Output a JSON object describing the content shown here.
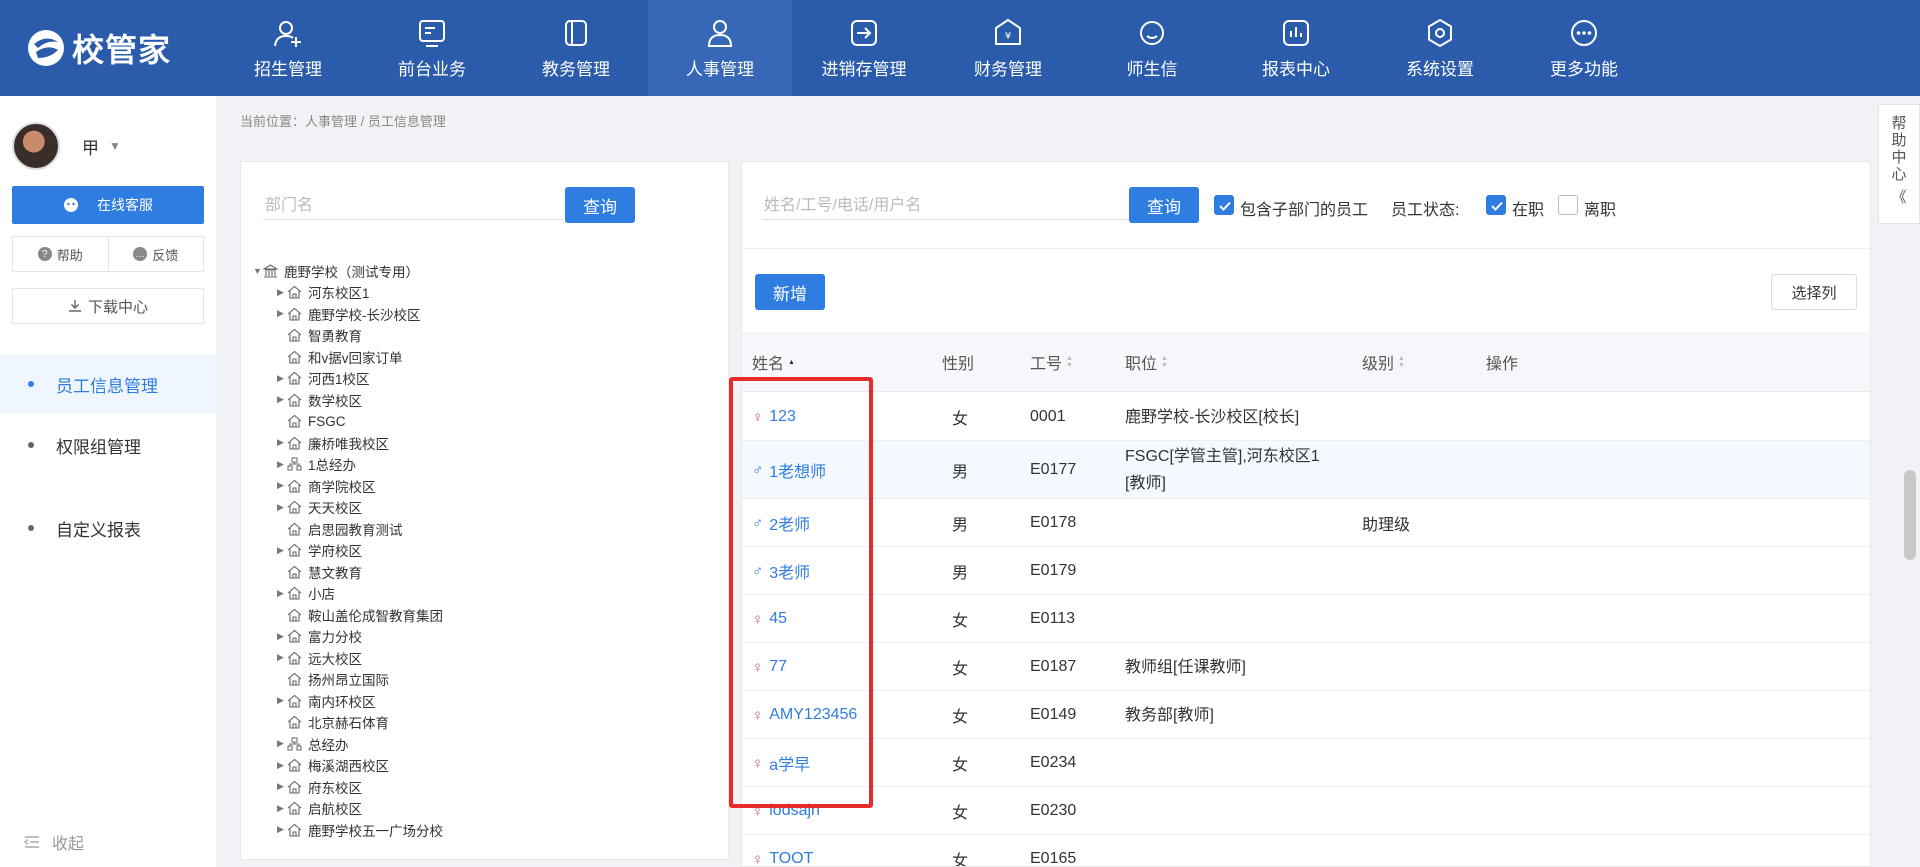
{
  "app": {
    "logo_text": "校管家",
    "brand_color": "#2b5cab",
    "accent": "#2f7de1"
  },
  "nav": [
    {
      "label": "招生管理",
      "icon": "user-plus-icon"
    },
    {
      "label": "前台业务",
      "icon": "monitor-icon"
    },
    {
      "label": "教务管理",
      "icon": "book-icon"
    },
    {
      "label": "人事管理",
      "icon": "person-icon",
      "active": true
    },
    {
      "label": "进销存管理",
      "icon": "exchange-icon"
    },
    {
      "label": "财务管理",
      "icon": "money-icon"
    },
    {
      "label": "师生信",
      "icon": "chat-icon"
    },
    {
      "label": "报表中心",
      "icon": "report-icon"
    },
    {
      "label": "系统设置",
      "icon": "settings-icon"
    },
    {
      "label": "更多功能",
      "icon": "more-icon"
    }
  ],
  "sidebar": {
    "user_name": "甲",
    "service_label": "在线客服",
    "help_label": "帮助",
    "feedback_label": "反馈",
    "download_label": "下载中心",
    "menu": [
      {
        "label": "员工信息管理",
        "active": true
      },
      {
        "label": "权限组管理"
      },
      {
        "label": "自定义报表"
      }
    ],
    "collapse_label": "收起"
  },
  "breadcrumb": "当前位置：人事管理 / 员工信息管理",
  "dept": {
    "search_placeholder": "部门名",
    "query_label": "查询",
    "tree": [
      {
        "label": "鹿野学校（测试专用）",
        "level": 0,
        "arrow": "▼",
        "icon": "bank-icon"
      },
      {
        "label": "河东校区1",
        "level": 1,
        "arrow": "▶",
        "icon": "house-icon"
      },
      {
        "label": "鹿野学校-长沙校区",
        "level": 1,
        "arrow": "▶",
        "icon": "house-icon"
      },
      {
        "label": "智勇教育",
        "level": 1,
        "arrow": "",
        "icon": "house-icon"
      },
      {
        "label": "和v据v回家订单",
        "level": 1,
        "arrow": "",
        "icon": "house-icon"
      },
      {
        "label": "河西1校区",
        "level": 1,
        "arrow": "▶",
        "icon": "house-icon"
      },
      {
        "label": "数学校区",
        "level": 1,
        "arrow": "▶",
        "icon": "house-icon"
      },
      {
        "label": "FSGC",
        "level": 1,
        "arrow": "",
        "icon": "house-icon"
      },
      {
        "label": "廉桥唯我校区",
        "level": 1,
        "arrow": "▶",
        "icon": "house-icon"
      },
      {
        "label": "1总经办",
        "level": 1,
        "arrow": "▶",
        "icon": "org-icon"
      },
      {
        "label": "商学院校区",
        "level": 1,
        "arrow": "▶",
        "icon": "house-icon"
      },
      {
        "label": "天天校区",
        "level": 1,
        "arrow": "▶",
        "icon": "house-icon"
      },
      {
        "label": "启思园教育测试",
        "level": 1,
        "arrow": "",
        "icon": "house-icon"
      },
      {
        "label": "学府校区",
        "level": 1,
        "arrow": "▶",
        "icon": "house-icon"
      },
      {
        "label": "慧文教育",
        "level": 1,
        "arrow": "",
        "icon": "house-icon"
      },
      {
        "label": "小店",
        "level": 1,
        "arrow": "▶",
        "icon": "house-icon"
      },
      {
        "label": "鞍山盖伦成智教育集团",
        "level": 1,
        "arrow": "",
        "icon": "house-icon"
      },
      {
        "label": "富力分校",
        "level": 1,
        "arrow": "▶",
        "icon": "house-icon"
      },
      {
        "label": "远大校区",
        "level": 1,
        "arrow": "▶",
        "icon": "house-icon"
      },
      {
        "label": "扬州昂立国际",
        "level": 1,
        "arrow": "",
        "icon": "house-icon"
      },
      {
        "label": "南内环校区",
        "level": 1,
        "arrow": "▶",
        "icon": "house-icon"
      },
      {
        "label": "北京赫石体育",
        "level": 1,
        "arrow": "",
        "icon": "house-icon"
      },
      {
        "label": "总经办",
        "level": 1,
        "arrow": "▶",
        "icon": "org-icon"
      },
      {
        "label": "梅溪湖西校区",
        "level": 1,
        "arrow": "▶",
        "icon": "house-icon"
      },
      {
        "label": "府东校区",
        "level": 1,
        "arrow": "▶",
        "icon": "house-icon"
      },
      {
        "label": "启航校区",
        "level": 1,
        "arrow": "▶",
        "icon": "house-icon"
      },
      {
        "label": "鹿野学校五一广场分校",
        "level": 1,
        "arrow": "▶",
        "icon": "house-icon"
      }
    ]
  },
  "emp": {
    "search_placeholder": "姓名/工号/电话/用户名",
    "query_label": "查询",
    "include_sub_label": "包含子部门的员工",
    "status_label": "员工状态:",
    "active_label": "在职",
    "left_label": "离职",
    "add_label": "新增",
    "choose_cols_label": "选择列",
    "columns": [
      "姓名",
      "性别",
      "工号",
      "职位",
      "级别",
      "操作"
    ],
    "rows": [
      {
        "name": "123",
        "gender": "女",
        "sym": "♀",
        "id": "0001",
        "position": "鹿野学校-长沙校区[校长]",
        "level": ""
      },
      {
        "name": "1老想师",
        "gender": "男",
        "sym": "♂",
        "id": "E0177",
        "position": "FSGC[学管主管],河东校区1",
        "position2": "[教师]",
        "level": ""
      },
      {
        "name": "2老师",
        "gender": "男",
        "sym": "♂",
        "id": "E0178",
        "position": "",
        "level": "助理级"
      },
      {
        "name": "3老师",
        "gender": "男",
        "sym": "♂",
        "id": "E0179",
        "position": "",
        "level": ""
      },
      {
        "name": "45",
        "gender": "女",
        "sym": "♀",
        "id": "E0113",
        "position": "",
        "level": ""
      },
      {
        "name": "77",
        "gender": "女",
        "sym": "♀",
        "id": "E0187",
        "position": "教师组[任课教师]",
        "level": ""
      },
      {
        "name": "AMY123456",
        "gender": "女",
        "sym": "♀",
        "id": "E0149",
        "position": "教务部[教师]",
        "level": ""
      },
      {
        "name": "a学早",
        "gender": "女",
        "sym": "♀",
        "id": "E0234",
        "position": "",
        "level": ""
      },
      {
        "name": "iodsajn",
        "gender": "女",
        "sym": "♀",
        "id": "E0230",
        "position": "",
        "level": ""
      },
      {
        "name": "TOOT",
        "gender": "女",
        "sym": "♀",
        "id": "E0165",
        "position": "",
        "level": ""
      }
    ]
  },
  "help_float": {
    "chars": [
      "帮",
      "助",
      "中",
      "心"
    ],
    "collapse": "《"
  }
}
